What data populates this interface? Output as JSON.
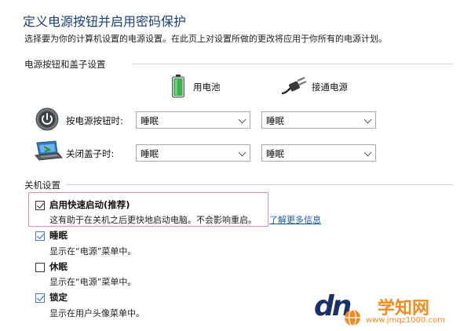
{
  "header": {
    "title": "定义电源按钮并启用密码保护",
    "subtitle": "选择要为你的计算机设置的电源设置。在此页上对设置所做的更改将应用于你所有的电源计划。"
  },
  "power_section": {
    "label": "电源按钮和盖子设置",
    "columns": {
      "battery": "用电池",
      "plugged_in": "接通电源"
    },
    "rows": {
      "power_button": {
        "label": "按电源按钮时:",
        "battery_value": "睡眠",
        "plugged_value": "睡眠"
      },
      "lid": {
        "label": "关闭盖子时:",
        "battery_value": "睡眠",
        "plugged_value": "睡眠"
      }
    }
  },
  "shutdown_section": {
    "label": "关机设置",
    "options": {
      "fast_startup": {
        "label": "启用快速启动(推荐)",
        "desc": "这有助于在关机之后更快地启动电脑。不会影响重启。",
        "link": "了解更多信息",
        "checked": true
      },
      "sleep": {
        "label": "睡眠",
        "desc": "显示在“电源”菜单中。",
        "checked": true
      },
      "hibernate": {
        "label": "休眠",
        "desc": "显示在“电源”菜单中。",
        "checked": false
      },
      "lock": {
        "label": "锁定",
        "desc": "显示在用户头像菜单中。",
        "checked": true
      }
    }
  },
  "watermark": {
    "brand": "dn",
    "site_name": "学知网",
    "site_url": "www.jmqz1000.com"
  },
  "colors": {
    "title": "#1d3f7a",
    "link": "#1a56c4",
    "highlight": "#e08fbd",
    "watermark_orange": "#f28a1e",
    "watermark_navy": "#1b2f6b"
  }
}
